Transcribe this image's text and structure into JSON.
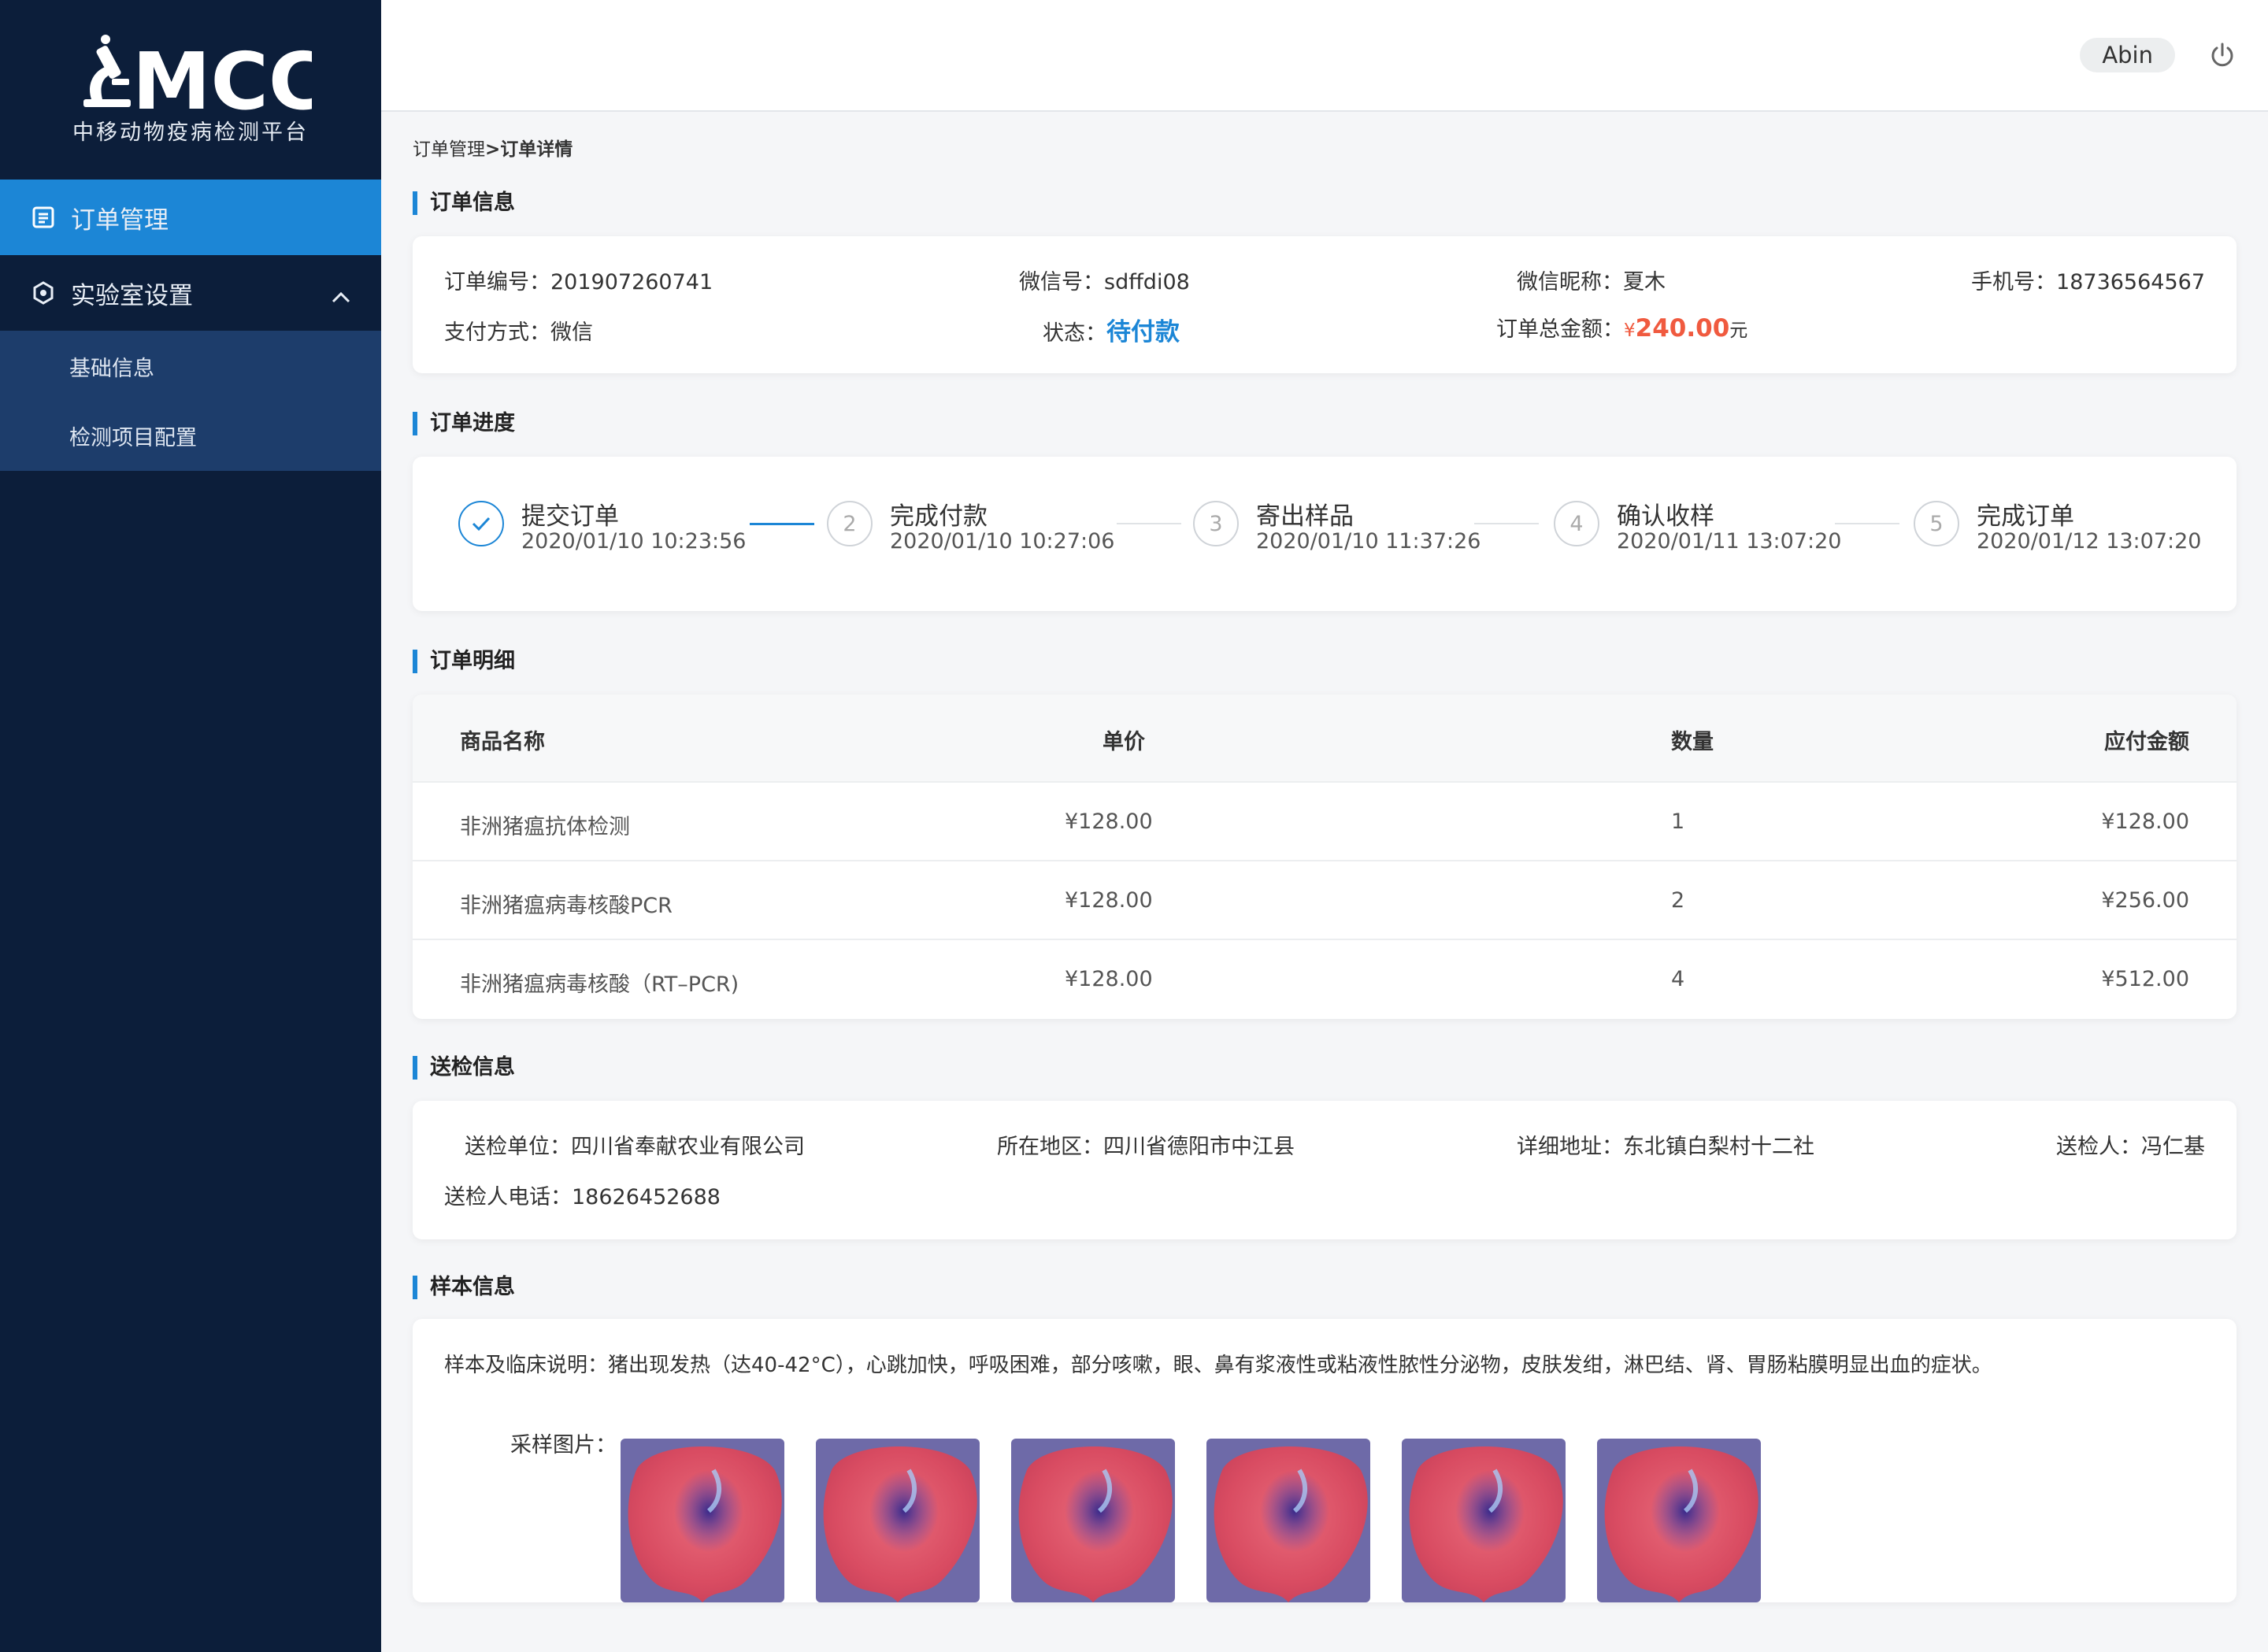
{
  "brand": {
    "logo_text": "MCC",
    "subtitle": "中移动物疫病检测平台"
  },
  "sidebar": {
    "items": [
      {
        "label": "订单管理",
        "icon": "document-icon"
      },
      {
        "label": "实验室设置",
        "icon": "settings-icon"
      }
    ],
    "subitems": [
      {
        "label": "基础信息"
      },
      {
        "label": "检测项目配置"
      }
    ]
  },
  "header": {
    "user": "Abin",
    "logout_icon": "power-icon"
  },
  "breadcrumb": {
    "parent": "订单管理",
    "separator": ">",
    "current": "订单详情"
  },
  "order_info": {
    "title": "订单信息",
    "order_no_label": "订单编号：",
    "order_no": "201907260741",
    "wechat_label": "微信号：",
    "wechat": "sdffdi08",
    "nickname_label": "微信昵称：",
    "nickname": "夏木",
    "phone_label": "手机号：",
    "phone": "18736564567",
    "pay_label": "支付方式：",
    "pay": "微信",
    "status_label": "状态：",
    "status": "待付款",
    "total_label": "订单总金额：",
    "total_symbol": "¥",
    "total": "240.00",
    "total_unit": "元",
    "status_color": "#1c86d6",
    "amount_color": "#f05a3f"
  },
  "progress": {
    "title": "订单进度",
    "steps": [
      {
        "no": "",
        "title": "提交订单",
        "time": "2020/01/10 10:23:56",
        "done": true
      },
      {
        "no": "2",
        "title": "完成付款",
        "time": "2020/01/10 10:27:06",
        "done": false
      },
      {
        "no": "3",
        "title": "寄出样品",
        "time": "2020/01/10 11:37:26",
        "done": false
      },
      {
        "no": "4",
        "title": "确认收样",
        "time": "2020/01/11 13:07:20",
        "done": false
      },
      {
        "no": "5",
        "title": "完成订单",
        "time": "2020/01/12 13:07:20",
        "done": false
      }
    ]
  },
  "details": {
    "title": "订单明细",
    "headers": [
      "商品名称",
      "单价",
      "数量",
      "应付金额"
    ],
    "rows": [
      [
        "非洲猪瘟抗体检测",
        "¥128.00",
        "1",
        "¥128.00"
      ],
      [
        "非洲猪瘟病毒核酸PCR",
        "¥128.00",
        "2",
        "¥256.00"
      ],
      [
        "非洲猪瘟病毒核酸（RT–PCR)",
        "¥128.00",
        "4",
        "¥512.00"
      ]
    ]
  },
  "sender": {
    "title": "送检信息",
    "unit_label": "送检单位：",
    "unit": "四川省奉献农业有限公司",
    "region_label": "所在地区：",
    "region": "四川省德阳市中江县",
    "address_label": "详细地址：",
    "address": "东北镇白梨村十二社",
    "person_label": "送检人：",
    "person": "冯仁基",
    "phone_label": "送检人电话：",
    "phone": "18626452688"
  },
  "sample": {
    "title": "样本信息",
    "desc_label": "样本及临床说明：",
    "desc": "猪出现发热（达40-42°C），心跳加快，呼吸困难，部分咳嗽，眼、鼻有浆液性或粘液性脓性分泌物，皮肤发绀，淋巴结、肾、胃肠粘膜明显出血的症状。",
    "images_label": "采样图片：",
    "image_count": 6
  },
  "accent_color": "#1c86d6"
}
